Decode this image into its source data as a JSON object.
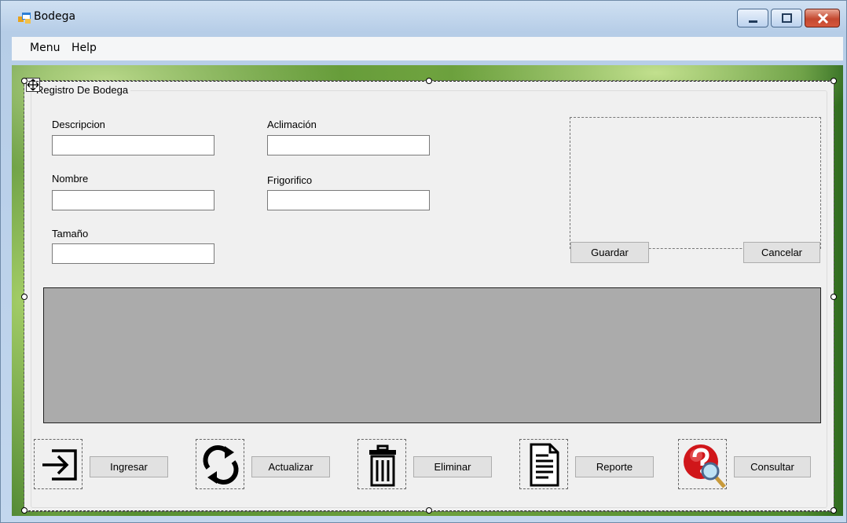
{
  "window": {
    "title": "Bodega",
    "icon": "form-icon",
    "controls": [
      "minimize-icon",
      "maximize-icon",
      "close-icon"
    ]
  },
  "menubar": {
    "items": [
      "Menu",
      "Help"
    ]
  },
  "group": {
    "title": "Registro De Bodega",
    "fields": {
      "descripcion": {
        "label": "Descripcion",
        "value": ""
      },
      "nombre": {
        "label": "Nombre",
        "value": ""
      },
      "tamano": {
        "label": "Tamaño",
        "value": ""
      },
      "aclimacion": {
        "label": "Aclimación",
        "value": ""
      },
      "frigorifico": {
        "label": "Frigorifico",
        "value": ""
      }
    },
    "buttons": {
      "guardar": "Guardar",
      "cancelar": "Cancelar"
    }
  },
  "actions": [
    {
      "icon": "sign-in-icon",
      "label": "Ingresar"
    },
    {
      "icon": "refresh-icon",
      "label": "Actualizar"
    },
    {
      "icon": "trash-icon",
      "label": "Eliminar"
    },
    {
      "icon": "document-icon",
      "label": "Reporte"
    },
    {
      "icon": "help-search-icon",
      "label": "Consultar"
    }
  ],
  "colors": {
    "form_background": "#f0f0f0",
    "grid_background": "#ababab",
    "button_background": "#e1e1e1"
  }
}
